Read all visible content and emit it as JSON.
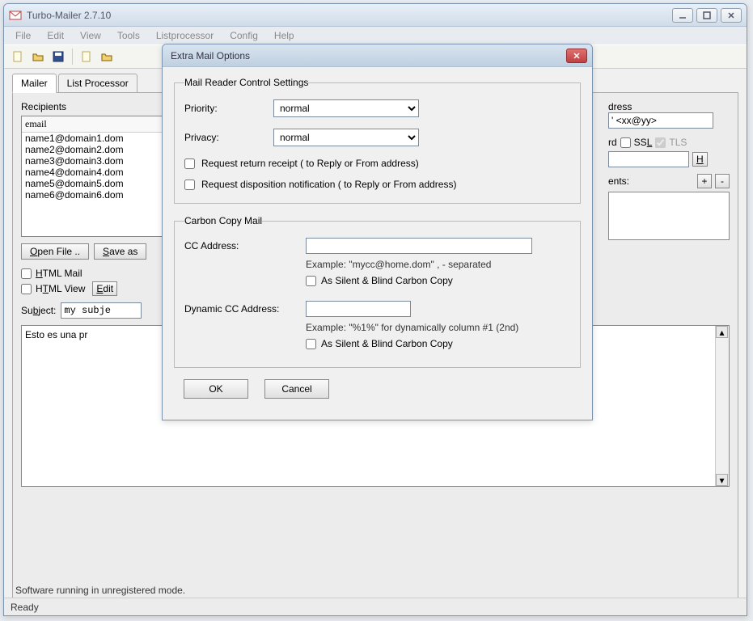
{
  "app": {
    "title": "Turbo-Mailer 2.7.10"
  },
  "menus": [
    "File",
    "Edit",
    "View",
    "Tools",
    "Listprocessor",
    "Config",
    "Help"
  ],
  "tabs": {
    "mailer": "Mailer",
    "listproc": "List Processor"
  },
  "recipients": {
    "legend": "Recipients",
    "bracket": "[",
    "header": "email",
    "rows": [
      "name1@domain1.dom",
      "name2@domain2.dom",
      "name3@domain3.dom",
      "name4@domain4.dom",
      "name5@domain5.dom",
      "name6@domain6.dom"
    ],
    "open_file": "Open File ..",
    "save_as": "Save as"
  },
  "mail_opts": {
    "html_mail": "HTML Mail",
    "html_view": "HTML View",
    "edit": "Edit"
  },
  "subject": {
    "label": "Subject:",
    "value": "my subje"
  },
  "body": "Esto es una pr",
  "right": {
    "dress": "dress",
    "hint": "' <xx@yy>",
    "rd": "rd",
    "ssl": "SSL",
    "tls": "TLS",
    "h": "H",
    "ents": "ents:",
    "plus": "+",
    "minus": "-"
  },
  "footer": {
    "reg": "Software running in unregistered mode.",
    "status": "Ready"
  },
  "dialog": {
    "title": "Extra Mail Options",
    "group1": {
      "legend": "Mail Reader Control Settings",
      "priority_label": "Priority:",
      "priority_value": "normal",
      "privacy_label": "Privacy:",
      "privacy_value": "normal",
      "receipt": "Request return receipt  ( to Reply or From address)",
      "disposition": "Request disposition notification  ( to Reply or From address)"
    },
    "group2": {
      "legend": "Carbon Copy Mail",
      "cc_label": "CC Address:",
      "cc_example": "Example: \"mycc@home.dom\"    , - separated",
      "cc_blind": "As Silent & Blind Carbon Copy",
      "dyn_label": "Dynamic CC Address:",
      "dyn_example": "Example: \"%1%\" for dynamically column #1 (2nd)",
      "dyn_blind": "As Silent & Blind Carbon Copy"
    },
    "ok": "OK",
    "cancel": "Cancel"
  }
}
